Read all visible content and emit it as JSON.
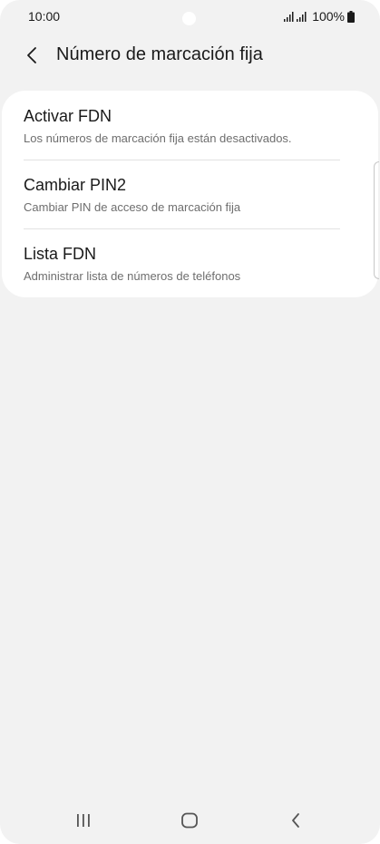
{
  "status_bar": {
    "time": "10:00",
    "battery": "100%"
  },
  "header": {
    "title": "Número de marcación fija"
  },
  "menu": {
    "items": [
      {
        "title": "Activar FDN",
        "subtitle": "Los números de marcación fija están desactivados."
      },
      {
        "title": "Cambiar PIN2",
        "subtitle": "Cambiar PIN de acceso de marcación fija"
      },
      {
        "title": "Lista FDN",
        "subtitle": "Administrar lista de números de teléfonos"
      }
    ]
  },
  "icons": {
    "back": "chevron-left-icon",
    "recents": "recent-apps-icon",
    "home": "home-icon",
    "nav_back": "back-icon",
    "signal": "signal-icon",
    "battery": "battery-icon"
  },
  "colors": {
    "background": "#f2f2f2",
    "card": "#ffffff",
    "text_primary": "#1a1a1a",
    "text_secondary": "#6e6e6e"
  }
}
